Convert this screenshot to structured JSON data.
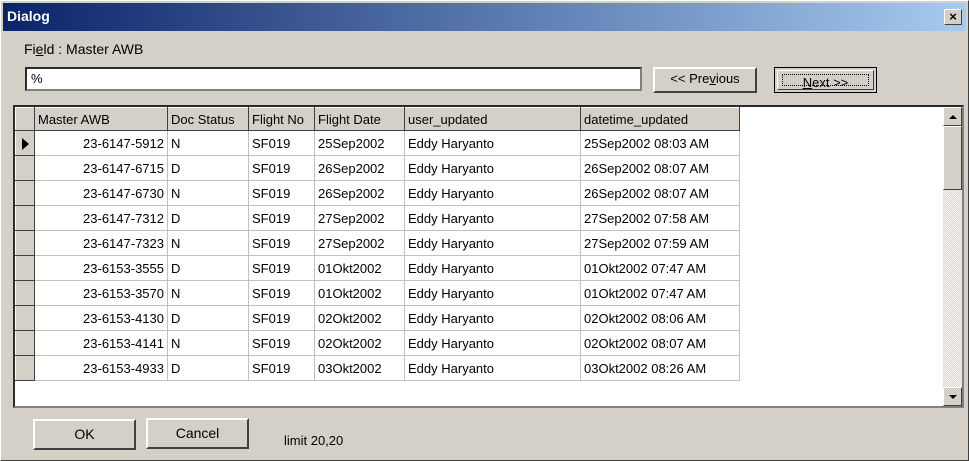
{
  "window": {
    "title": "Dialog",
    "close_glyph": "×"
  },
  "field": {
    "label_prefix": "Fi",
    "label_hotkey": "e",
    "label_suffix": "ld : Master AWB",
    "value": "%"
  },
  "nav": {
    "prev_prefix": "<< Pre",
    "prev_hotkey": "v",
    "prev_suffix": "ious",
    "next_hotkey": "N",
    "next_suffix": "ext >>"
  },
  "grid": {
    "columns": [
      "Master AWB",
      "Doc Status",
      "Flight No",
      "Flight Date",
      "user_updated",
      "datetime_updated"
    ],
    "rows": [
      [
        "23-6147-5912",
        "N",
        "SF019",
        "25Sep2002",
        "Eddy  Haryanto",
        "25Sep2002  08:03 AM"
      ],
      [
        "23-6147-6715",
        "D",
        "SF019",
        "26Sep2002",
        "Eddy  Haryanto",
        "26Sep2002  08:07 AM"
      ],
      [
        "23-6147-6730",
        "N",
        "SF019",
        "26Sep2002",
        "Eddy  Haryanto",
        "26Sep2002  08:07 AM"
      ],
      [
        "23-6147-7312",
        "D",
        "SF019",
        "27Sep2002",
        "Eddy  Haryanto",
        "27Sep2002  07:58 AM"
      ],
      [
        "23-6147-7323",
        "N",
        "SF019",
        "27Sep2002",
        "Eddy  Haryanto",
        "27Sep2002  07:59 AM"
      ],
      [
        "23-6153-3555",
        "D",
        "SF019",
        "01Okt2002",
        "Eddy  Haryanto",
        "01Okt2002  07:47 AM"
      ],
      [
        "23-6153-3570",
        "N",
        "SF019",
        "01Okt2002",
        "Eddy  Haryanto",
        "01Okt2002  07:47 AM"
      ],
      [
        "23-6153-4130",
        "D",
        "SF019",
        "02Okt2002",
        "Eddy  Haryanto",
        "02Okt2002  08:06 AM"
      ],
      [
        "23-6153-4141",
        "N",
        "SF019",
        "02Okt2002",
        "Eddy  Haryanto",
        "02Okt2002  08:07 AM"
      ],
      [
        "23-6153-4933",
        "D",
        "SF019",
        "03Okt2002",
        "Eddy  Haryanto",
        "03Okt2002  08:26 AM"
      ]
    ]
  },
  "footer": {
    "ok_label": "OK",
    "cancel_label": "Cancel",
    "limit_text": "limit 20,20"
  }
}
